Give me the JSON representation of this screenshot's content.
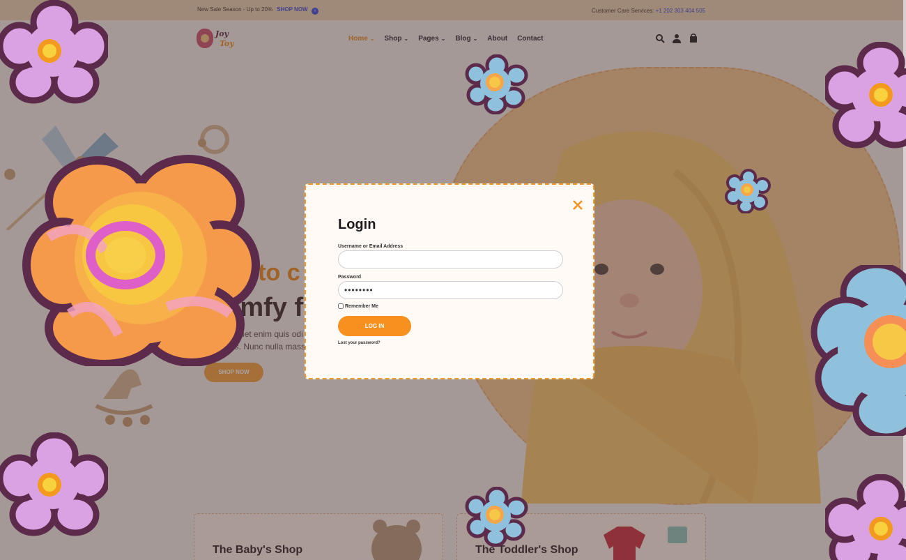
{
  "topbar": {
    "sale_text": "New Sale Season - Up to 20%",
    "shop_now": "SHOP NOW",
    "care_label": "Customer Care Services:",
    "care_phone": "+1 202 303 404 505"
  },
  "logo": {
    "line1": "Joy",
    "line2": "Toy"
  },
  "nav": {
    "items": [
      {
        "label": "Home",
        "dropdown": true,
        "active": true
      },
      {
        "label": "Shop",
        "dropdown": true
      },
      {
        "label": "Pages",
        "dropdown": true
      },
      {
        "label": "Blog",
        "dropdown": true
      },
      {
        "label": "About",
        "dropdown": false
      },
      {
        "label": "Contact",
        "dropdown": false
      }
    ],
    "icons": [
      "search-icon",
      "user-icon",
      "cart-icon"
    ]
  },
  "hero": {
    "title_partial_1": "n to c",
    "title_partial_2": "comfy f",
    "text_line1": "is alquet enim quis odi",
    "text_line2": "vallis. Nunc nulla massa e",
    "button": "SHOP NOW"
  },
  "cards": [
    {
      "title": "The Baby's Shop"
    },
    {
      "title": "The Toddler's Shop"
    }
  ],
  "login": {
    "title": "Login",
    "username_label": "Username or Email Address",
    "username_value": "",
    "password_label": "Password",
    "password_value": "••••••••",
    "remember_label": "Remember Me",
    "submit": "LOG IN",
    "lost_password": "Lost your password?"
  },
  "colors": {
    "accent": "#f7901e",
    "link_blue": "#3f4fd8",
    "topbar_bg": "#e8cfae",
    "overlay": "rgba(70,50,55,0.45)"
  }
}
